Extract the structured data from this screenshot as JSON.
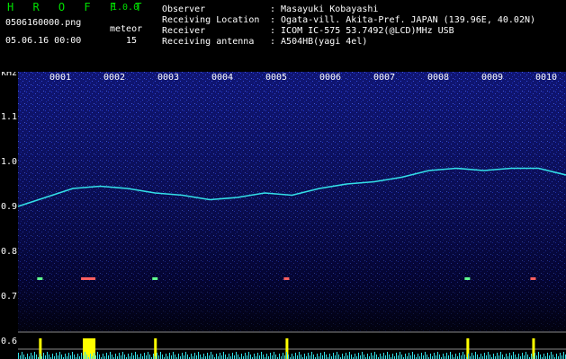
{
  "app": {
    "title": "H R O F F T",
    "version": "1.0.0",
    "file_name": "0506160000.png",
    "datetime": "05.06.16 00:00",
    "meteor_label": "meteor",
    "meteor_count": "15"
  },
  "metadata": [
    {
      "label": "Observer",
      "value": ": Masayuki Kobayashi"
    },
    {
      "label": "Receiving Location",
      "value": ": Ogata-vill. Akita-Pref. JAPAN (139.96E, 40.02N)"
    },
    {
      "label": "Receiver",
      "value": ": ICOM IC-575 53.7492(@LCD)MHz USB"
    },
    {
      "label": "Receiving antenna",
      "value": ": A504HB(yagi 4el)"
    }
  ],
  "chart_data": {
    "type": "heatmap",
    "ylabel": "kHz",
    "y_ticks": [
      "1.1",
      "1.0",
      "0.9",
      "0.8",
      "0.7",
      "0.6"
    ],
    "time_labels": [
      "0001",
      "0002",
      "0003",
      "0004",
      "0005",
      "0006",
      "0007",
      "0008",
      "0009",
      "0010"
    ],
    "colors": {
      "background": "#0a0a5a",
      "noise": "#2b44ff",
      "trace": "#33e0e8",
      "signal_bar": "#ffff00"
    },
    "trace_khz": [
      0.9,
      0.92,
      0.94,
      0.945,
      0.94,
      0.93,
      0.925,
      0.915,
      0.92,
      0.93,
      0.925,
      0.94,
      0.95,
      0.955,
      0.965,
      0.98,
      0.985,
      0.98,
      0.985,
      0.985,
      0.97
    ],
    "meteor_echo_times": [
      0.04,
      0.12,
      0.25,
      0.49,
      0.82,
      0.94
    ]
  }
}
